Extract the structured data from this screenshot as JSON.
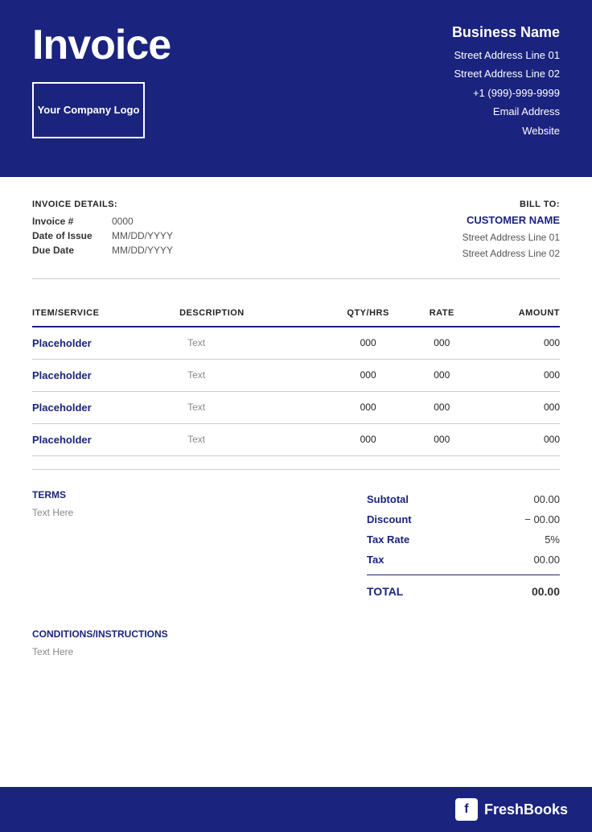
{
  "header": {
    "title": "Invoice",
    "logo_text": "Your Company Logo",
    "business": {
      "name": "Business Name",
      "address1": "Street Address Line 01",
      "address2": "Street Address Line 02",
      "phone": "+1 (999)-999-9999",
      "email": "Email Address",
      "website": "Website"
    }
  },
  "invoice_details": {
    "section_title": "INVOICE DETAILS:",
    "invoice_label": "Invoice #",
    "invoice_value": "0000",
    "issue_label": "Date of Issue",
    "issue_value": "MM/DD/YYYY",
    "due_label": "Due Date",
    "due_value": "MM/DD/YYYY"
  },
  "bill_to": {
    "section_title": "BILL TO:",
    "customer_name": "CUSTOMER NAME",
    "address1": "Street Address Line 01",
    "address2": "Street Address Line 02"
  },
  "table": {
    "headers": {
      "item": "ITEM/SERVICE",
      "description": "DESCRIPTION",
      "qty": "QTY/HRS",
      "rate": "RATE",
      "amount": "AMOUNT"
    },
    "rows": [
      {
        "item": "Placeholder",
        "description": "Text",
        "qty": "000",
        "rate": "000",
        "amount": "000"
      },
      {
        "item": "Placeholder",
        "description": "Text",
        "qty": "000",
        "rate": "000",
        "amount": "000"
      },
      {
        "item": "Placeholder",
        "description": "Text",
        "qty": "000",
        "rate": "000",
        "amount": "000"
      },
      {
        "item": "Placeholder",
        "description": "Text",
        "qty": "000",
        "rate": "000",
        "amount": "000"
      }
    ]
  },
  "terms": {
    "title": "TERMS",
    "text": "Text Here"
  },
  "totals": {
    "subtotal_label": "Subtotal",
    "subtotal_value": "00.00",
    "discount_label": "Discount",
    "discount_value": "− 00.00",
    "taxrate_label": "Tax Rate",
    "taxrate_value": "5%",
    "tax_label": "Tax",
    "tax_value": "00.00",
    "total_label": "TOTAL",
    "total_value": "00.00"
  },
  "conditions": {
    "title": "CONDITIONS/INSTRUCTIONS",
    "text": "Text Here"
  },
  "footer": {
    "brand": "FreshBooks",
    "icon_letter": "f"
  }
}
